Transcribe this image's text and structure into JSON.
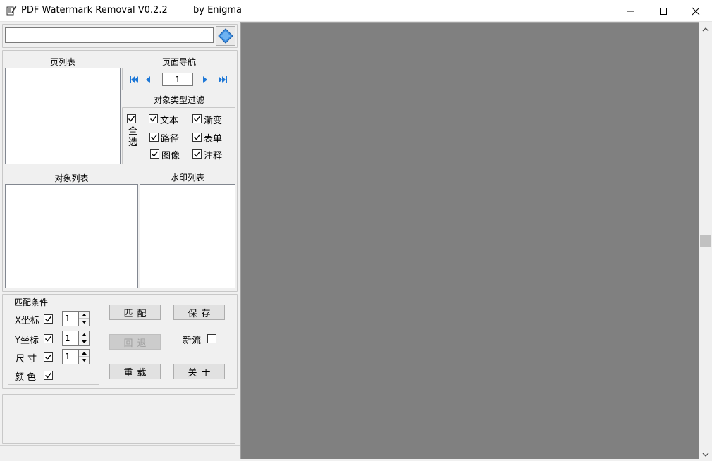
{
  "window": {
    "title": "PDF Watermark Removal   V0.2.2",
    "author": "by  Enigma",
    "icons": {
      "app": "pen-document-icon",
      "minimize": "minimize-icon",
      "maximize": "maximize-icon",
      "close": "close-icon"
    }
  },
  "file": {
    "path_value": "",
    "open_icon": "diamond-open-icon"
  },
  "page_list": {
    "title": "页列表",
    "items": []
  },
  "page_nav": {
    "title": "页面导航",
    "page_value": "1",
    "icons": [
      "first-page-icon",
      "prev-page-icon",
      "next-page-icon",
      "last-page-icon"
    ]
  },
  "type_filter": {
    "title": "对象类型过滤",
    "select_all": "全\n选",
    "select_all_checked": true,
    "options": [
      {
        "label": "文本",
        "checked": true
      },
      {
        "label": "渐变",
        "checked": true
      },
      {
        "label": "路径",
        "checked": true
      },
      {
        "label": "表单",
        "checked": true
      },
      {
        "label": "图像",
        "checked": true
      },
      {
        "label": "注释",
        "checked": true
      }
    ]
  },
  "object_list": {
    "title": "对象列表",
    "items": []
  },
  "watermark_list": {
    "title": "水印列表",
    "items": []
  },
  "match": {
    "title": "匹配条件",
    "x": {
      "label": "X坐标",
      "checked": true,
      "value": "1"
    },
    "y": {
      "label": "Y坐标",
      "checked": true,
      "value": "1"
    },
    "size": {
      "label": "尺 寸",
      "checked": true,
      "value": "1"
    },
    "color": {
      "label": "颜 色",
      "checked": true
    }
  },
  "actions": {
    "match": "匹配",
    "save": "保存",
    "undo": "回退",
    "reload": "重载",
    "about": "关于",
    "new_stream_label": "新流",
    "new_stream_checked": false
  },
  "colors": {
    "preview_bg": "#808080",
    "nav_icon": "#1e78d7"
  }
}
